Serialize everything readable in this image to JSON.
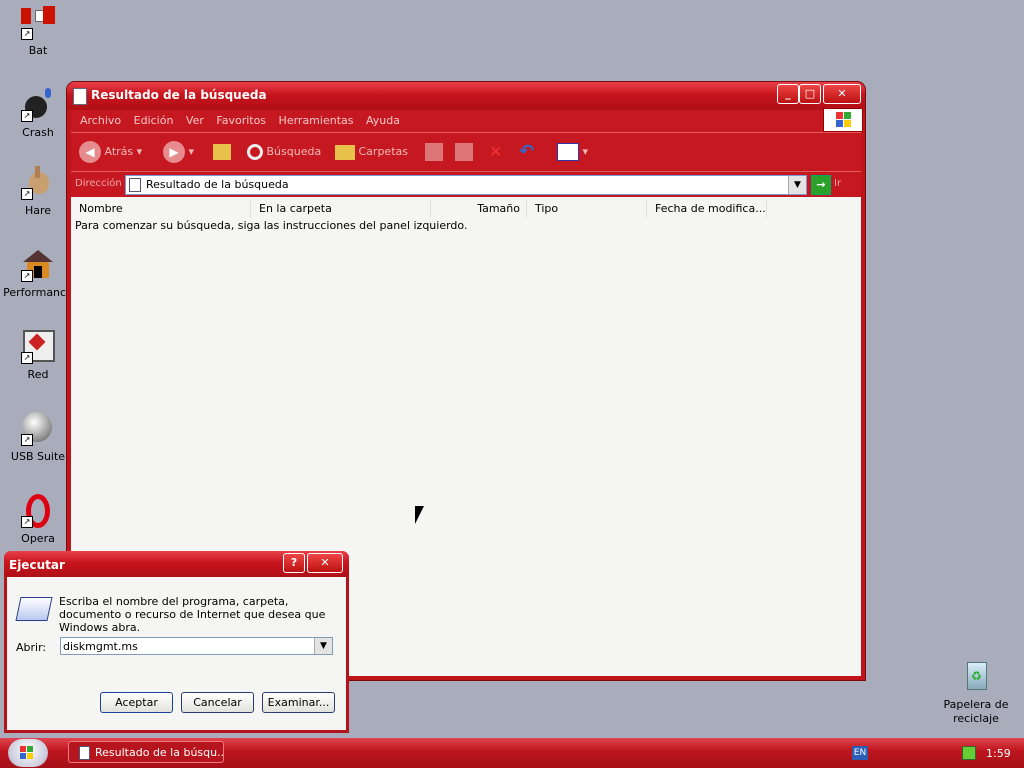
{
  "desktop": {
    "icons": [
      {
        "label": "Bat"
      },
      {
        "label": "Crash"
      },
      {
        "label": "Hare"
      },
      {
        "label": "Performance"
      },
      {
        "label": "Red"
      },
      {
        "label": "USB Suite"
      },
      {
        "label": "Opera"
      }
    ],
    "recycle_bin": {
      "label_line1": "Papelera de",
      "label_line2": "reciclaje"
    }
  },
  "explorer": {
    "title": "Resultado de la búsqueda",
    "menu": [
      "Archivo",
      "Edición",
      "Ver",
      "Favoritos",
      "Herramientas",
      "Ayuda"
    ],
    "toolbar": {
      "back": "Atrás",
      "search": "Búsqueda",
      "folders": "Carpetas"
    },
    "address": {
      "label": "Dirección",
      "value": "Resultado de la búsqueda",
      "go_label": "Ir"
    },
    "columns": [
      "Nombre",
      "En la carpeta",
      "Tamaño",
      "Tipo",
      "Fecha de modifica..."
    ],
    "hint": "Para comenzar su búsqueda, siga las instrucciones del panel izquierdo."
  },
  "run_dialog": {
    "title": "Ejecutar",
    "help": "?",
    "close": "✕",
    "description": "Escriba el nombre del programa, carpeta, documento o recurso de Internet que desea que Windows abra.",
    "open_label": "Abrir:",
    "open_value": "diskmgmt.ms",
    "ok": "Aceptar",
    "cancel": "Cancelar",
    "browse": "Examinar..."
  },
  "taskbar": {
    "task_label": "Resultado de la búsqu...",
    "language": "EN",
    "clock": "1:59"
  },
  "colors": {
    "theme_red": "#c61820",
    "desktop": "#a9adbb"
  }
}
